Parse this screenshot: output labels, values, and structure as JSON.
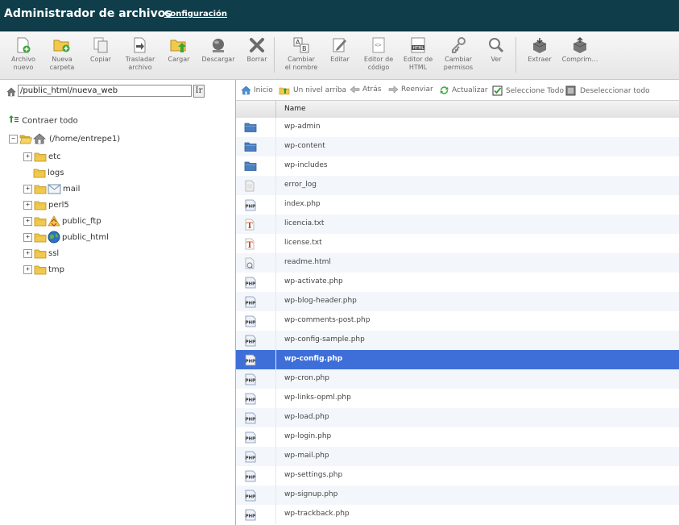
{
  "app": {
    "title": "Administrador de archivos",
    "config_link": "Configuración"
  },
  "toolbar": [
    {
      "lines": [
        "Archivo",
        "nuevo"
      ],
      "icon": "new-file-icon"
    },
    {
      "lines": [
        "Nueva",
        "carpeta"
      ],
      "icon": "new-folder-icon"
    },
    {
      "lines": [
        "Copiar"
      ],
      "icon": "copy-icon"
    },
    {
      "lines": [
        "Trasladar",
        "archivo"
      ],
      "icon": "move-file-icon"
    },
    {
      "lines": [
        "Cargar"
      ],
      "icon": "upload-icon"
    },
    {
      "lines": [
        "Descargar"
      ],
      "icon": "download-icon"
    },
    {
      "lines": [
        "Borrar"
      ],
      "icon": "delete-icon"
    },
    {
      "lines": [
        "Cambiar",
        "el nombre"
      ],
      "icon": "rename-icon"
    },
    {
      "lines": [
        "Editar"
      ],
      "icon": "edit-icon"
    },
    {
      "lines": [
        "Editor de",
        "código"
      ],
      "icon": "code-editor-icon"
    },
    {
      "lines": [
        "Editor de",
        "HTML"
      ],
      "icon": "html-editor-icon"
    },
    {
      "lines": [
        "Cambiar",
        "permisos"
      ],
      "icon": "permissions-icon"
    },
    {
      "lines": [
        "Ver"
      ],
      "icon": "view-icon"
    },
    {
      "lines": [
        "Extraer"
      ],
      "icon": "extract-icon"
    },
    {
      "lines": [
        "Comprim…"
      ],
      "icon": "compress-icon"
    }
  ],
  "path": {
    "value": "/public_html/nueva_web",
    "go_label": "Ir"
  },
  "tree": {
    "collapse_label": "Contraer todo",
    "root_label": "(/home/entrepe1)",
    "items": [
      {
        "label": "etc",
        "expandable": true,
        "icon": "folder-icon"
      },
      {
        "label": "logs",
        "expandable": false,
        "icon": "folder-icon"
      },
      {
        "label": "mail",
        "expandable": true,
        "icon": "mail-icon"
      },
      {
        "label": "perl5",
        "expandable": true,
        "icon": "folder-icon"
      },
      {
        "label": "public_ftp",
        "expandable": true,
        "icon": "ftp-icon"
      },
      {
        "label": "public_html",
        "expandable": true,
        "icon": "globe-icon"
      },
      {
        "label": "ssl",
        "expandable": true,
        "icon": "folder-icon"
      },
      {
        "label": "tmp",
        "expandable": true,
        "icon": "folder-icon"
      }
    ]
  },
  "nav": {
    "home": "Inicio",
    "up": "Un nivel arriba",
    "back": "Atrás",
    "forward": "Reenviar",
    "refresh": "Actualizar",
    "select_all": "Seleccione Todo",
    "deselect_all": "Deseleccionar todo"
  },
  "table": {
    "column_name": "Name",
    "selected_index": 12,
    "rows": [
      {
        "name": "wp-admin",
        "type": "folder"
      },
      {
        "name": "wp-content",
        "type": "folder"
      },
      {
        "name": "wp-includes",
        "type": "folder"
      },
      {
        "name": "error_log",
        "type": "file"
      },
      {
        "name": "index.php",
        "type": "php"
      },
      {
        "name": "licencia.txt",
        "type": "txt"
      },
      {
        "name": "license.txt",
        "type": "txt"
      },
      {
        "name": "readme.html",
        "type": "html"
      },
      {
        "name": "wp-activate.php",
        "type": "php"
      },
      {
        "name": "wp-blog-header.php",
        "type": "php"
      },
      {
        "name": "wp-comments-post.php",
        "type": "php"
      },
      {
        "name": "wp-config-sample.php",
        "type": "php"
      },
      {
        "name": "wp-config.php",
        "type": "php"
      },
      {
        "name": "wp-cron.php",
        "type": "php"
      },
      {
        "name": "wp-links-opml.php",
        "type": "php"
      },
      {
        "name": "wp-load.php",
        "type": "php"
      },
      {
        "name": "wp-login.php",
        "type": "php"
      },
      {
        "name": "wp-mail.php",
        "type": "php"
      },
      {
        "name": "wp-settings.php",
        "type": "php"
      },
      {
        "name": "wp-signup.php",
        "type": "php"
      },
      {
        "name": "wp-trackback.php",
        "type": "php"
      }
    ]
  },
  "colors": {
    "header_bg": "#0f3d4a",
    "selected_row": "#3e6fd8",
    "alt_row": "#f3f7fb"
  }
}
